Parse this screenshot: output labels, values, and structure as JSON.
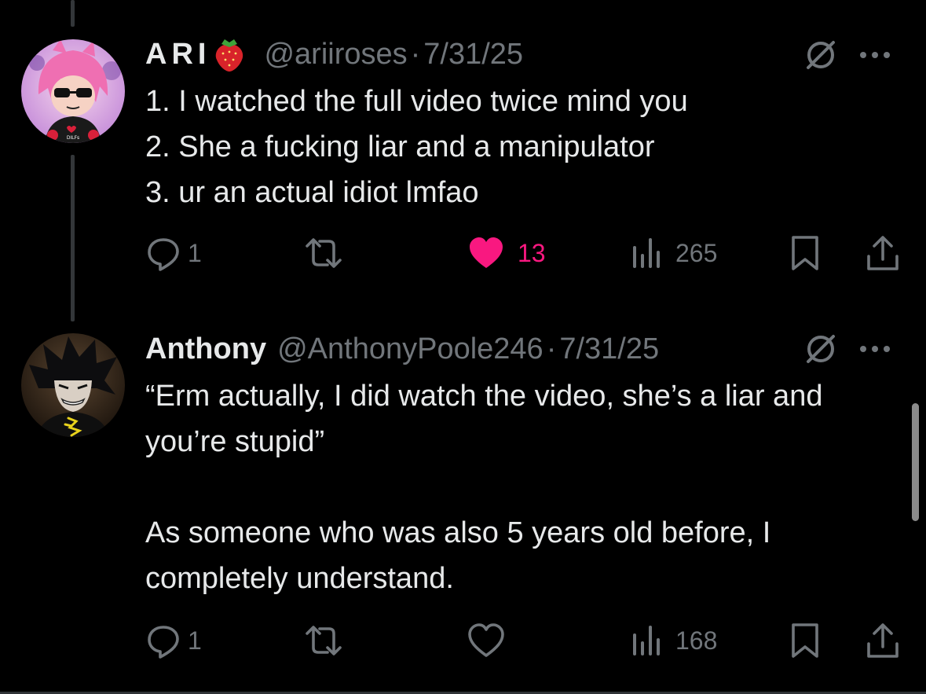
{
  "tweets": [
    {
      "display_name": "ARI",
      "name_emoji": "strawberry",
      "handle": "@ariiroses",
      "separator": "·",
      "date": "7/31/25",
      "text": "1. I watched the full video twice mind you\n2. She a fucking liar and a manipulator\n3. ur an actual idiot lmfao",
      "actions": {
        "replies": "1",
        "reposts": "",
        "likes": "13",
        "liked": true,
        "views": "265"
      },
      "avatar": "pink-hair-sunglasses-avatar",
      "avatar_shirt_text": "I DILFs"
    },
    {
      "display_name": "Anthony",
      "handle": "@AnthonyPoole246",
      "separator": "·",
      "date": "7/31/25",
      "text": "“Erm actually, I did watch the video, she’s a liar and you’re stupid”\n\nAs someone who was also 5 years old before, I completely understand.",
      "actions": {
        "replies": "1",
        "reposts": "",
        "likes": "",
        "liked": false,
        "views": "168"
      },
      "avatar": "dark-spiky-hair-avatar"
    }
  ],
  "icons": {
    "reply": "reply-bubble-icon",
    "repost": "repost-arrows-icon",
    "like": "heart-icon",
    "views": "views-bars-icon",
    "bookmark": "bookmark-icon",
    "share": "share-upload-icon",
    "grok": "grok-slash-circle-icon",
    "more": "more-dots-icon"
  },
  "colors": {
    "background": "#000000",
    "text_primary": "#e7e9ea",
    "text_secondary": "#71767b",
    "like_pink": "#f91880",
    "thread_line": "#333639"
  }
}
